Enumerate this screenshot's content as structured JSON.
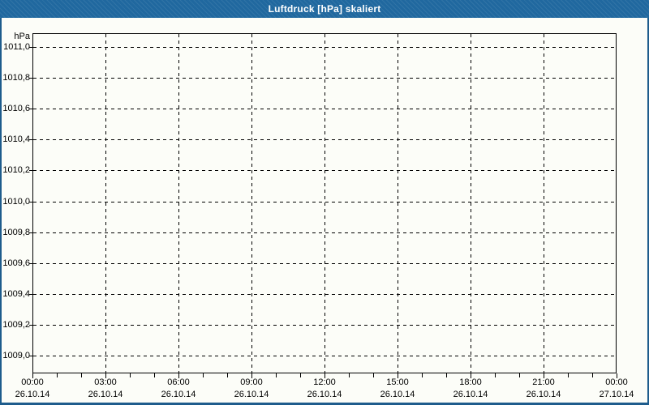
{
  "window": {
    "title": "Luftdruck [hPa] skaliert"
  },
  "colors": {
    "titlebar": "#20689f",
    "window_border": "#1e5c8c",
    "plot_border": "#000000",
    "grid": "#000000",
    "background": "#fcfdf8",
    "title_text": "#ffffff",
    "label_text": "#000000"
  },
  "chart_data": {
    "type": "line",
    "title": "Luftdruck [hPa] skaliert",
    "xlabel": "",
    "ylabel": "hPa",
    "ylim": [
      1009.0,
      1011.0
    ],
    "y_tick_step": 0.2,
    "y_tick_labels": [
      "1011,0",
      "1010,8",
      "1010,6",
      "1010,4",
      "1010,2",
      "1010,0",
      "1009,8",
      "1009,6",
      "1009,4",
      "1009,2",
      "1009,0"
    ],
    "x_ticks": [
      {
        "time": "00:00",
        "date": "26.10.14"
      },
      {
        "time": "03:00",
        "date": "26.10.14"
      },
      {
        "time": "06:00",
        "date": "26.10.14"
      },
      {
        "time": "09:00",
        "date": "26.10.14"
      },
      {
        "time": "12:00",
        "date": "26.10.14"
      },
      {
        "time": "15:00",
        "date": "26.10.14"
      },
      {
        "time": "18:00",
        "date": "26.10.14"
      },
      {
        "time": "21:00",
        "date": "26.10.14"
      },
      {
        "time": "00:00",
        "date": "27.10.14"
      }
    ],
    "x_minor_ticks_per_major": 3,
    "grid": "dashed",
    "legend": null,
    "series": []
  }
}
